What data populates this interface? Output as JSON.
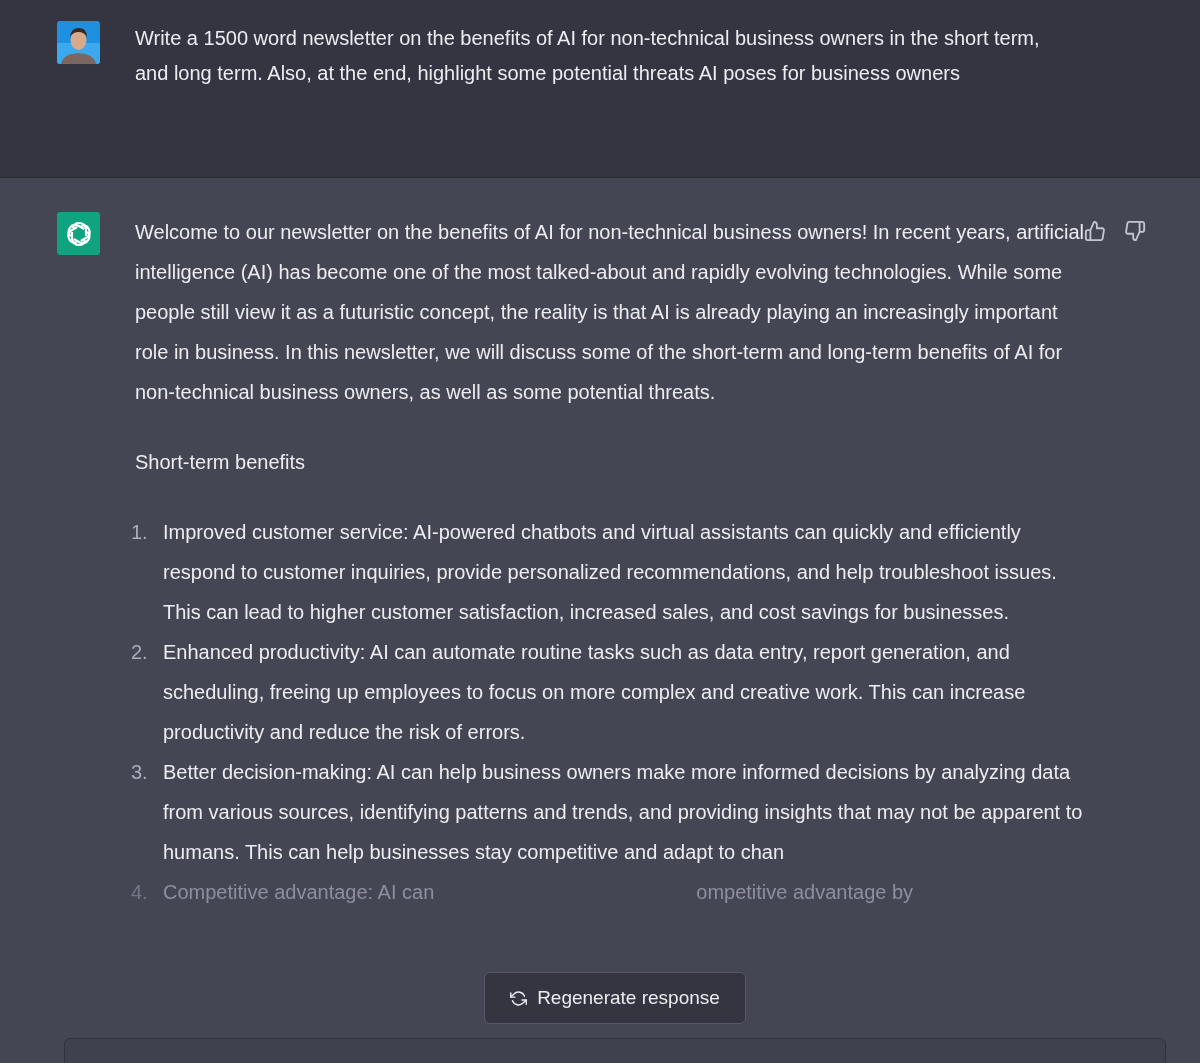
{
  "user_message": {
    "text": "Write a 1500 word newsletter on the benefits of AI for non-technical business owners in the short term, and long term. Also, at the end, highlight some potential threats AI poses for business owners"
  },
  "assistant_message": {
    "intro": "Welcome to our newsletter on the benefits of AI for non-technical business owners! In recent years, artificial intelligence (AI) has become one of the most talked-about and rapidly evolving technologies. While some people still view it as a futuristic concept, the reality is that AI is already playing an increasingly important role in business. In this newsletter, we will discuss some of the short-term and long-term benefits of AI for non-technical business owners, as well as some potential threats.",
    "heading": "Short-term benefits",
    "list": [
      {
        "number": "1.",
        "text": "Improved customer service: AI-powered chatbots and virtual assistants can quickly and efficiently respond to customer inquiries, provide personalized recommendations, and help troubleshoot issues. This can lead to higher customer satisfaction, increased sales, and cost savings for businesses.",
        "faded": false
      },
      {
        "number": "2.",
        "text": "Enhanced productivity: AI can automate routine tasks such as data entry, report generation, and scheduling, freeing up employees to focus on more complex and creative work. This can increase productivity and reduce the risk of errors.",
        "faded": false
      },
      {
        "number": "3.",
        "text": "Better decision-making: AI can help business owners make more informed decisions by analyzing data from various sources, identifying patterns and trends, and providing insights that may not be apparent to humans. This can help businesses stay competitive and adapt to chan",
        "faded": false
      },
      {
        "number": "4.",
        "text": "Competitive advantage: AI can",
        "text_after_button": "ompetitive advantage by",
        "faded": true
      }
    ]
  },
  "regenerate_button": {
    "label": "Regenerate response"
  }
}
